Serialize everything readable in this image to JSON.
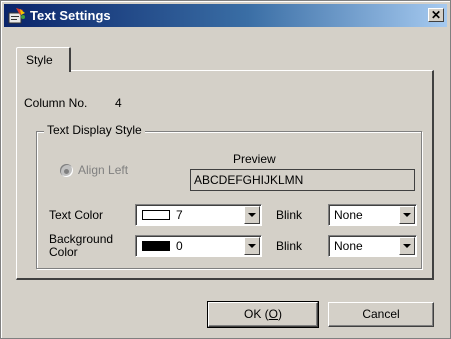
{
  "window": {
    "title": "Text Settings",
    "close_glyph": "✕"
  },
  "tabs": [
    {
      "label": "Style",
      "selected": true
    }
  ],
  "column": {
    "label": "Column No.",
    "value": "4"
  },
  "group": {
    "title": "Text Display Style"
  },
  "align": {
    "label": "Align Left",
    "enabled": false,
    "checked": true
  },
  "preview": {
    "label": "Preview",
    "text": "ABCDEFGHIJKLMN"
  },
  "text_color": {
    "label": "Text Color",
    "value": "7",
    "swatch": "#ffffff"
  },
  "background_color": {
    "label_line1": "Background",
    "label_line2": "Color",
    "value": "0",
    "swatch": "#000000"
  },
  "blink1": {
    "label": "Blink",
    "value": "None"
  },
  "blink2": {
    "label": "Blink",
    "value": "None"
  },
  "buttons": {
    "ok_prefix": "OK (",
    "ok_mnemonic": "O",
    "ok_suffix": ")",
    "cancel": "Cancel"
  },
  "colors": {
    "title_start": "#0a246a",
    "title_end": "#a6caf0",
    "face": "#d4d0c8"
  }
}
